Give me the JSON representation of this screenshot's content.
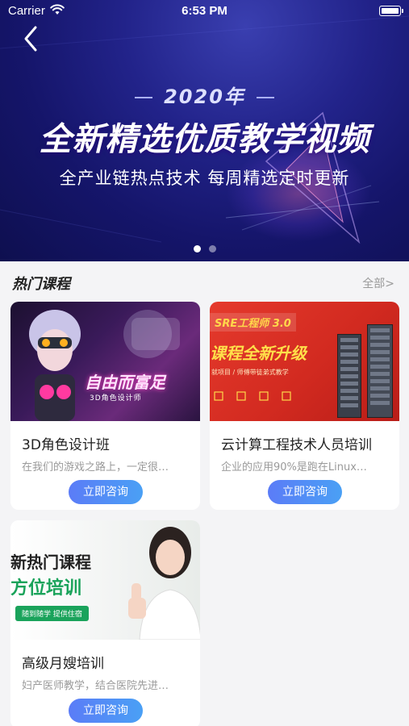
{
  "status_bar": {
    "carrier": "Carrier",
    "time": "6:53 PM"
  },
  "banner": {
    "year": "2020年",
    "title": "全新精选优质教学视频",
    "subtitle": "全产业链热点技术 每周精选定时更新",
    "page_count": 2,
    "active_page": 1
  },
  "section": {
    "title": "热门课程",
    "see_all": "全部>"
  },
  "courses": [
    {
      "title": "3D角色设计班",
      "desc": "在我们的游戏之路上，一定很…",
      "button": "立即咨询",
      "thumb_text": "自由而富足",
      "thumb_sub": "3D角色设计师"
    },
    {
      "title": "云计算工程技术人员培训",
      "desc": "企业的应用90%是跑在Linux…",
      "button": "立即咨询",
      "thumb_tag": "SRE工程师 3.0",
      "thumb_text": "课程全新升级",
      "thumb_sub": "就项目 / 师傅带徒弟式教学"
    },
    {
      "title": "高级月嫂培训",
      "desc": "妇产医师教学，结合医院先进…",
      "button": "立即咨询",
      "thumb_line1": "新热门课程",
      "thumb_line2": "方位培训",
      "thumb_pill": "随到随学 提供住宿"
    }
  ],
  "colors": {
    "accent": "#5b7cf7",
    "banner_bg": "#1a1a7a",
    "page_bg": "#f4f4f6"
  }
}
